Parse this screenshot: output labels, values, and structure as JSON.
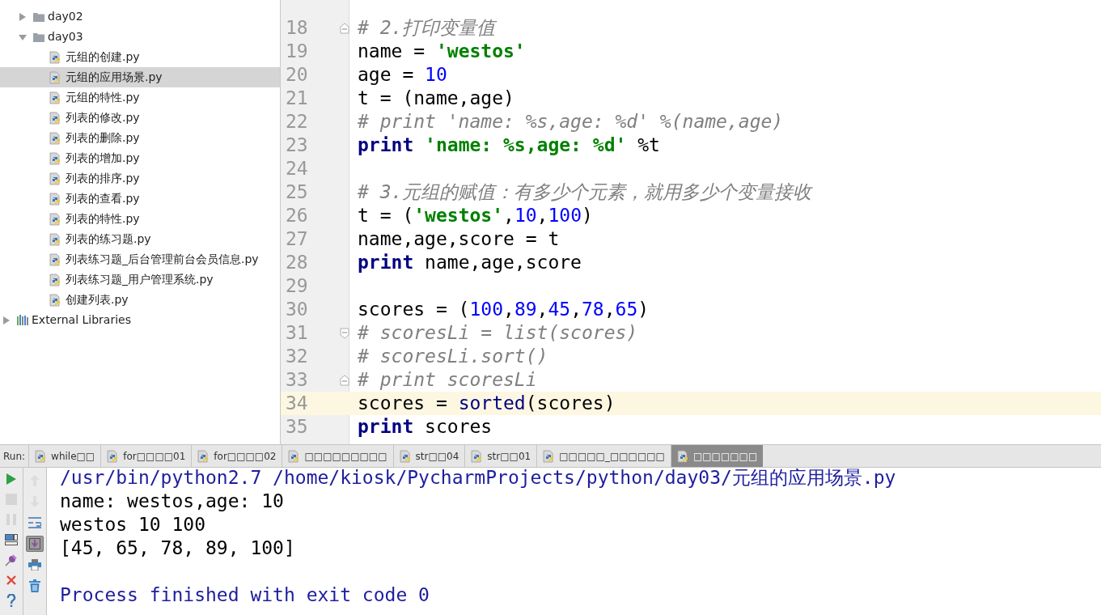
{
  "tree": [
    {
      "kind": "hidden-root",
      "children": [
        {
          "label": "day02",
          "kind": "folder",
          "expanded": false,
          "selected": false
        },
        {
          "label": "day03",
          "kind": "folder",
          "expanded": true,
          "selected": false,
          "children": [
            {
              "label": "元组的创建.py",
              "kind": "file",
              "selected": false
            },
            {
              "label": "元组的应用场景.py",
              "kind": "file",
              "selected": true
            },
            {
              "label": "元组的特性.py",
              "kind": "file",
              "selected": false
            },
            {
              "label": "列表的修改.py",
              "kind": "file",
              "selected": false
            },
            {
              "label": "列表的删除.py",
              "kind": "file",
              "selected": false
            },
            {
              "label": "列表的增加.py",
              "kind": "file",
              "selected": false
            },
            {
              "label": "列表的排序.py",
              "kind": "file",
              "selected": false
            },
            {
              "label": "列表的查看.py",
              "kind": "file",
              "selected": false
            },
            {
              "label": "列表的特性.py",
              "kind": "file",
              "selected": false
            },
            {
              "label": "列表的练习题.py",
              "kind": "file",
              "selected": false
            },
            {
              "label": "列表练习题_后台管理前台会员信息.py",
              "kind": "file",
              "selected": false
            },
            {
              "label": "列表练习题_用户管理系统.py",
              "kind": "file",
              "selected": false
            },
            {
              "label": "创建列表.py",
              "kind": "file",
              "selected": false
            }
          ]
        }
      ]
    },
    {
      "label": "External Libraries",
      "kind": "library",
      "expanded": false,
      "selected": false
    }
  ],
  "editor": {
    "lines": [
      {
        "number": "18",
        "fold_end": true,
        "tokens": [
          {
            "kind": "comment",
            "text": "# 2.打印变量值"
          }
        ]
      },
      {
        "number": "19",
        "tokens": [
          {
            "kind": "plain",
            "text": "name = "
          },
          {
            "kind": "string",
            "text": "'westos'"
          }
        ]
      },
      {
        "number": "20",
        "tokens": [
          {
            "kind": "plain",
            "text": "age = "
          },
          {
            "kind": "number",
            "text": "10"
          }
        ]
      },
      {
        "number": "21",
        "tokens": [
          {
            "kind": "plain",
            "text": "t = (name,age)"
          }
        ]
      },
      {
        "number": "22",
        "tokens": [
          {
            "kind": "comment",
            "text": "# print 'name: %s,age: %d' %(name,age)"
          }
        ]
      },
      {
        "number": "23",
        "tokens": [
          {
            "kind": "keyword",
            "text": "print"
          },
          {
            "kind": "string",
            "space_before": true,
            "text": "'name: %s,age: %d'"
          },
          {
            "kind": "plain",
            "text": " %t"
          }
        ]
      },
      {
        "number": "24"
      },
      {
        "number": "25",
        "tokens": [
          {
            "kind": "comment",
            "text": "# 3.元组的赋值：有多少个元素，就用多少个变量接收"
          }
        ]
      },
      {
        "number": "26",
        "tokens": [
          {
            "kind": "plain",
            "text": "t = ("
          },
          {
            "kind": "string",
            "text": "'westos'"
          },
          {
            "kind": "plain",
            "text": ","
          },
          {
            "kind": "number",
            "text": "10"
          },
          {
            "kind": "plain",
            "text": ","
          },
          {
            "kind": "number",
            "text": "100"
          },
          {
            "kind": "plain",
            "text": ")"
          }
        ]
      },
      {
        "number": "27",
        "tokens": [
          {
            "kind": "plain",
            "text": "name,age,score = t"
          }
        ]
      },
      {
        "number": "28",
        "tokens": [
          {
            "kind": "keyword",
            "text": "print"
          },
          {
            "kind": "plain",
            "text": " name,age,score"
          }
        ]
      },
      {
        "number": "29"
      },
      {
        "number": "30",
        "tokens": [
          {
            "kind": "plain",
            "text": "scores = ("
          },
          {
            "kind": "number",
            "text": "100"
          },
          {
            "kind": "plain",
            "text": ","
          },
          {
            "kind": "number",
            "text": "89"
          },
          {
            "kind": "plain",
            "text": ","
          },
          {
            "kind": "number",
            "text": "45"
          },
          {
            "kind": "plain",
            "text": ","
          },
          {
            "kind": "number",
            "text": "78"
          },
          {
            "kind": "plain",
            "text": ","
          },
          {
            "kind": "number",
            "text": "65"
          },
          {
            "kind": "plain",
            "text": ")"
          }
        ]
      },
      {
        "number": "31",
        "fold_start": true,
        "tokens": [
          {
            "kind": "comment",
            "text": "# scoresLi = list(scores)"
          }
        ]
      },
      {
        "number": "32",
        "tokens": [
          {
            "kind": "comment",
            "text": "# scoresLi.sort()"
          }
        ]
      },
      {
        "number": "33",
        "fold_end": true,
        "tokens": [
          {
            "kind": "comment",
            "text": "# print scoresLi"
          }
        ]
      },
      {
        "number": "34",
        "current": true,
        "tokens": [
          {
            "kind": "plain",
            "text": "scores = "
          },
          {
            "kind": "builtin",
            "text": "sorted"
          },
          {
            "kind": "plain",
            "text": "(scores)"
          }
        ]
      },
      {
        "number": "35",
        "tokens": [
          {
            "kind": "keyword",
            "text": "print"
          },
          {
            "kind": "plain",
            "text": " scores"
          }
        ]
      }
    ]
  },
  "run": {
    "label": "Run:",
    "tabs": [
      {
        "label": "while□□",
        "selected": false
      },
      {
        "label": "for□□□□01",
        "selected": false
      },
      {
        "label": "for□□□□02",
        "selected": false
      },
      {
        "label": "□□□□□□□□□",
        "selected": false
      },
      {
        "label": "str□□04",
        "selected": false
      },
      {
        "label": "str□□01",
        "selected": false
      },
      {
        "label": "□□□□□_□□□□□□",
        "selected": false
      },
      {
        "label": "□□□□□□□",
        "selected": true
      }
    ],
    "tools_left": [
      {
        "kind": "run",
        "disabled": false
      },
      {
        "kind": "stop",
        "disabled": true
      },
      {
        "kind": "pause",
        "disabled": true
      },
      {
        "kind": "layout",
        "disabled": false
      },
      {
        "kind": "pin",
        "disabled": false
      },
      {
        "kind": "close",
        "disabled": false
      },
      {
        "kind": "help",
        "disabled": false
      }
    ],
    "tools_right": [
      {
        "kind": "up",
        "disabled": true,
        "on": false
      },
      {
        "kind": "down",
        "disabled": true,
        "on": false
      },
      {
        "kind": "wrap",
        "disabled": false,
        "on": false
      },
      {
        "kind": "scroll-end",
        "disabled": false,
        "on": true
      },
      {
        "kind": "print",
        "disabled": false,
        "on": false
      },
      {
        "kind": "trash",
        "disabled": false,
        "on": false
      }
    ],
    "console": [
      {
        "kind": "command",
        "text": "/usr/bin/python2.7 /home/kiosk/PycharmProjects/python/day03/元组的应用场景.py"
      },
      {
        "kind": "output",
        "text": "name: westos,age: 10"
      },
      {
        "kind": "output",
        "text": "westos 10 100"
      },
      {
        "kind": "output",
        "text": "[45, 65, 78, 89, 100]"
      },
      {
        "kind": "exit",
        "text": "Process finished with exit code 0"
      }
    ]
  }
}
